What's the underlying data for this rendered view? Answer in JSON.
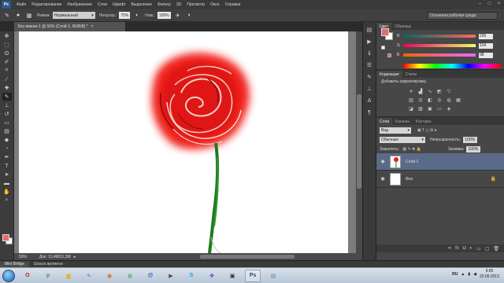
{
  "menubar": {
    "logo": "Ps",
    "items": [
      "Файл",
      "Редактирование",
      "Изображение",
      "Слои",
      "Шрифт",
      "Выделение",
      "Фильтр",
      "3D",
      "Просмотр",
      "Окно",
      "Справка"
    ],
    "window_controls": [
      "–",
      "□",
      "×"
    ]
  },
  "options_bar": {
    "mode_label": "Режим:",
    "mode_value": "Нормальный",
    "opacity_label": "Непрозр.:",
    "opacity_value": "75%",
    "flow_label": "Наж.:",
    "flow_value": "100%",
    "workspace": "Основная рабочая среда"
  },
  "document": {
    "tab_title": "Без имени-1 @ 50% (Слой 1, RGB/8) *",
    "close": "×",
    "zoom": "50%",
    "doc_info": "Док: 11,4M/11,3M",
    "status_arrow": "▸"
  },
  "mini_bridge": {
    "tabs": [
      "Mini Bridge",
      "Шкала времени"
    ]
  },
  "color_panel": {
    "tabs": [
      "Цвет",
      "Образцы"
    ],
    "foreground": "#e86a6a",
    "r_label": "R",
    "r_value": "236",
    "g_label": "G",
    "g_value": "104",
    "b_label": "B",
    "b_value": "98"
  },
  "adjustments_panel": {
    "tabs": [
      "Коррекция",
      "Стили"
    ],
    "title": "Добавить корректировку"
  },
  "layers_panel": {
    "tabs": [
      "Слои",
      "Каналы",
      "Контуры"
    ],
    "filter_value": "Вид",
    "blend_mode": "Обычные",
    "opacity_label": "Непрозрачность:",
    "opacity_value": "100%",
    "lock_label": "Закрепить:",
    "fill_label": "Заливка:",
    "fill_value": "100%",
    "layers": [
      {
        "name": "Слой 1",
        "active": true
      },
      {
        "name": "Фон",
        "active": false
      }
    ]
  },
  "taskbar": {
    "apps": [
      {
        "icon": "opera-icon",
        "glyph": "O",
        "color": "#cc1b1b"
      },
      {
        "icon": "utorrent-icon",
        "glyph": "µ",
        "color": "#3e9a2e"
      },
      {
        "icon": "folder-icon",
        "glyph": "▆",
        "color": "#e0b341"
      },
      {
        "icon": "paint-icon",
        "glyph": "✎",
        "color": "#4b7fb8"
      },
      {
        "icon": "firefox-icon",
        "glyph": "◉",
        "color": "#e0661b"
      },
      {
        "icon": "chrome-icon",
        "glyph": "◍",
        "color": "#3a9a3a"
      },
      {
        "icon": "email-icon",
        "glyph": "@",
        "color": "#2a68b0"
      },
      {
        "icon": "video-icon",
        "glyph": "▶",
        "color": "#4a4a4a"
      },
      {
        "icon": "skype-icon",
        "glyph": "S",
        "color": "#00a9e9"
      },
      {
        "icon": "pinwheel-icon",
        "glyph": "✤",
        "color": "#7a3aa8"
      },
      {
        "icon": "dark-app-icon",
        "glyph": "▣",
        "color": "#303030"
      },
      {
        "icon": "photoshop-icon",
        "glyph": "Ps",
        "color": "#1e4e86"
      },
      {
        "icon": "document-icon",
        "glyph": "▤",
        "color": "#5a7fa8"
      }
    ],
    "lang": "RU",
    "time": "9:05",
    "date": "22.05.2013"
  }
}
